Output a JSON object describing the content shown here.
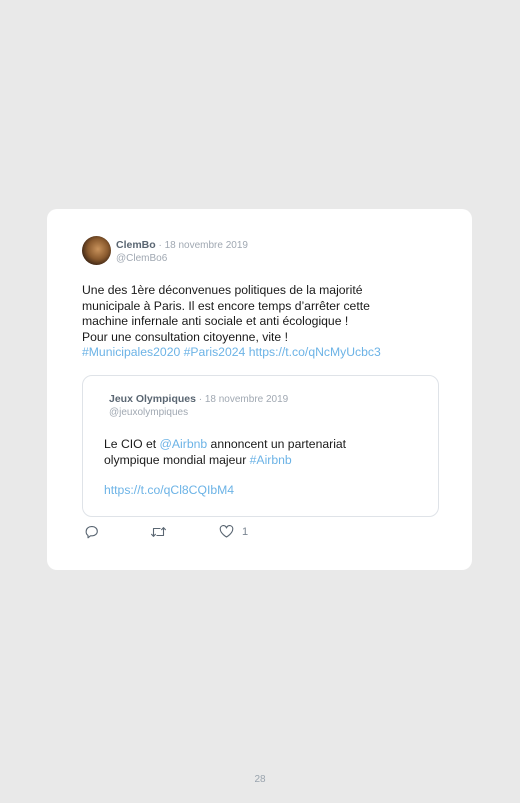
{
  "tweet": {
    "author_name": "ClemBo",
    "separator": " · ",
    "date": "18 novembre 2019",
    "handle": "@ClemBo6",
    "text_lines": [
      "Une des 1ère déconvenues politiques de la majorité",
      "municipale à Paris. Il est encore temps d’arrêter cette",
      "machine infernale anti sociale et anti écologique !",
      "Pour une consultation citoyenne, vite !"
    ],
    "hashtag1": "#Municipales2020",
    "hashtag2": "#Paris2024",
    "url": "https://t.co/qNcMyUcbc3"
  },
  "quoted": {
    "author_name": "Jeux Olympiques",
    "separator": " · ",
    "date": "18 novembre 2019",
    "handle": "@jeuxolympiques",
    "text_part1": "Le CIO et ",
    "mention": "@Airbnb",
    "text_part2": " annoncent un partenariat",
    "text_line2": "olympique mondial majeur ",
    "hashtag": "#Airbnb",
    "url": "https://t.co/qCl8CQIbM4"
  },
  "actions": {
    "like_count": "1"
  },
  "page_number": "28",
  "colors": {
    "link": "#6cb3e6",
    "background": "#e9e9e9",
    "card": "#ffffff"
  },
  "icons": [
    "reply-icon",
    "retweet-icon",
    "heart-icon"
  ]
}
